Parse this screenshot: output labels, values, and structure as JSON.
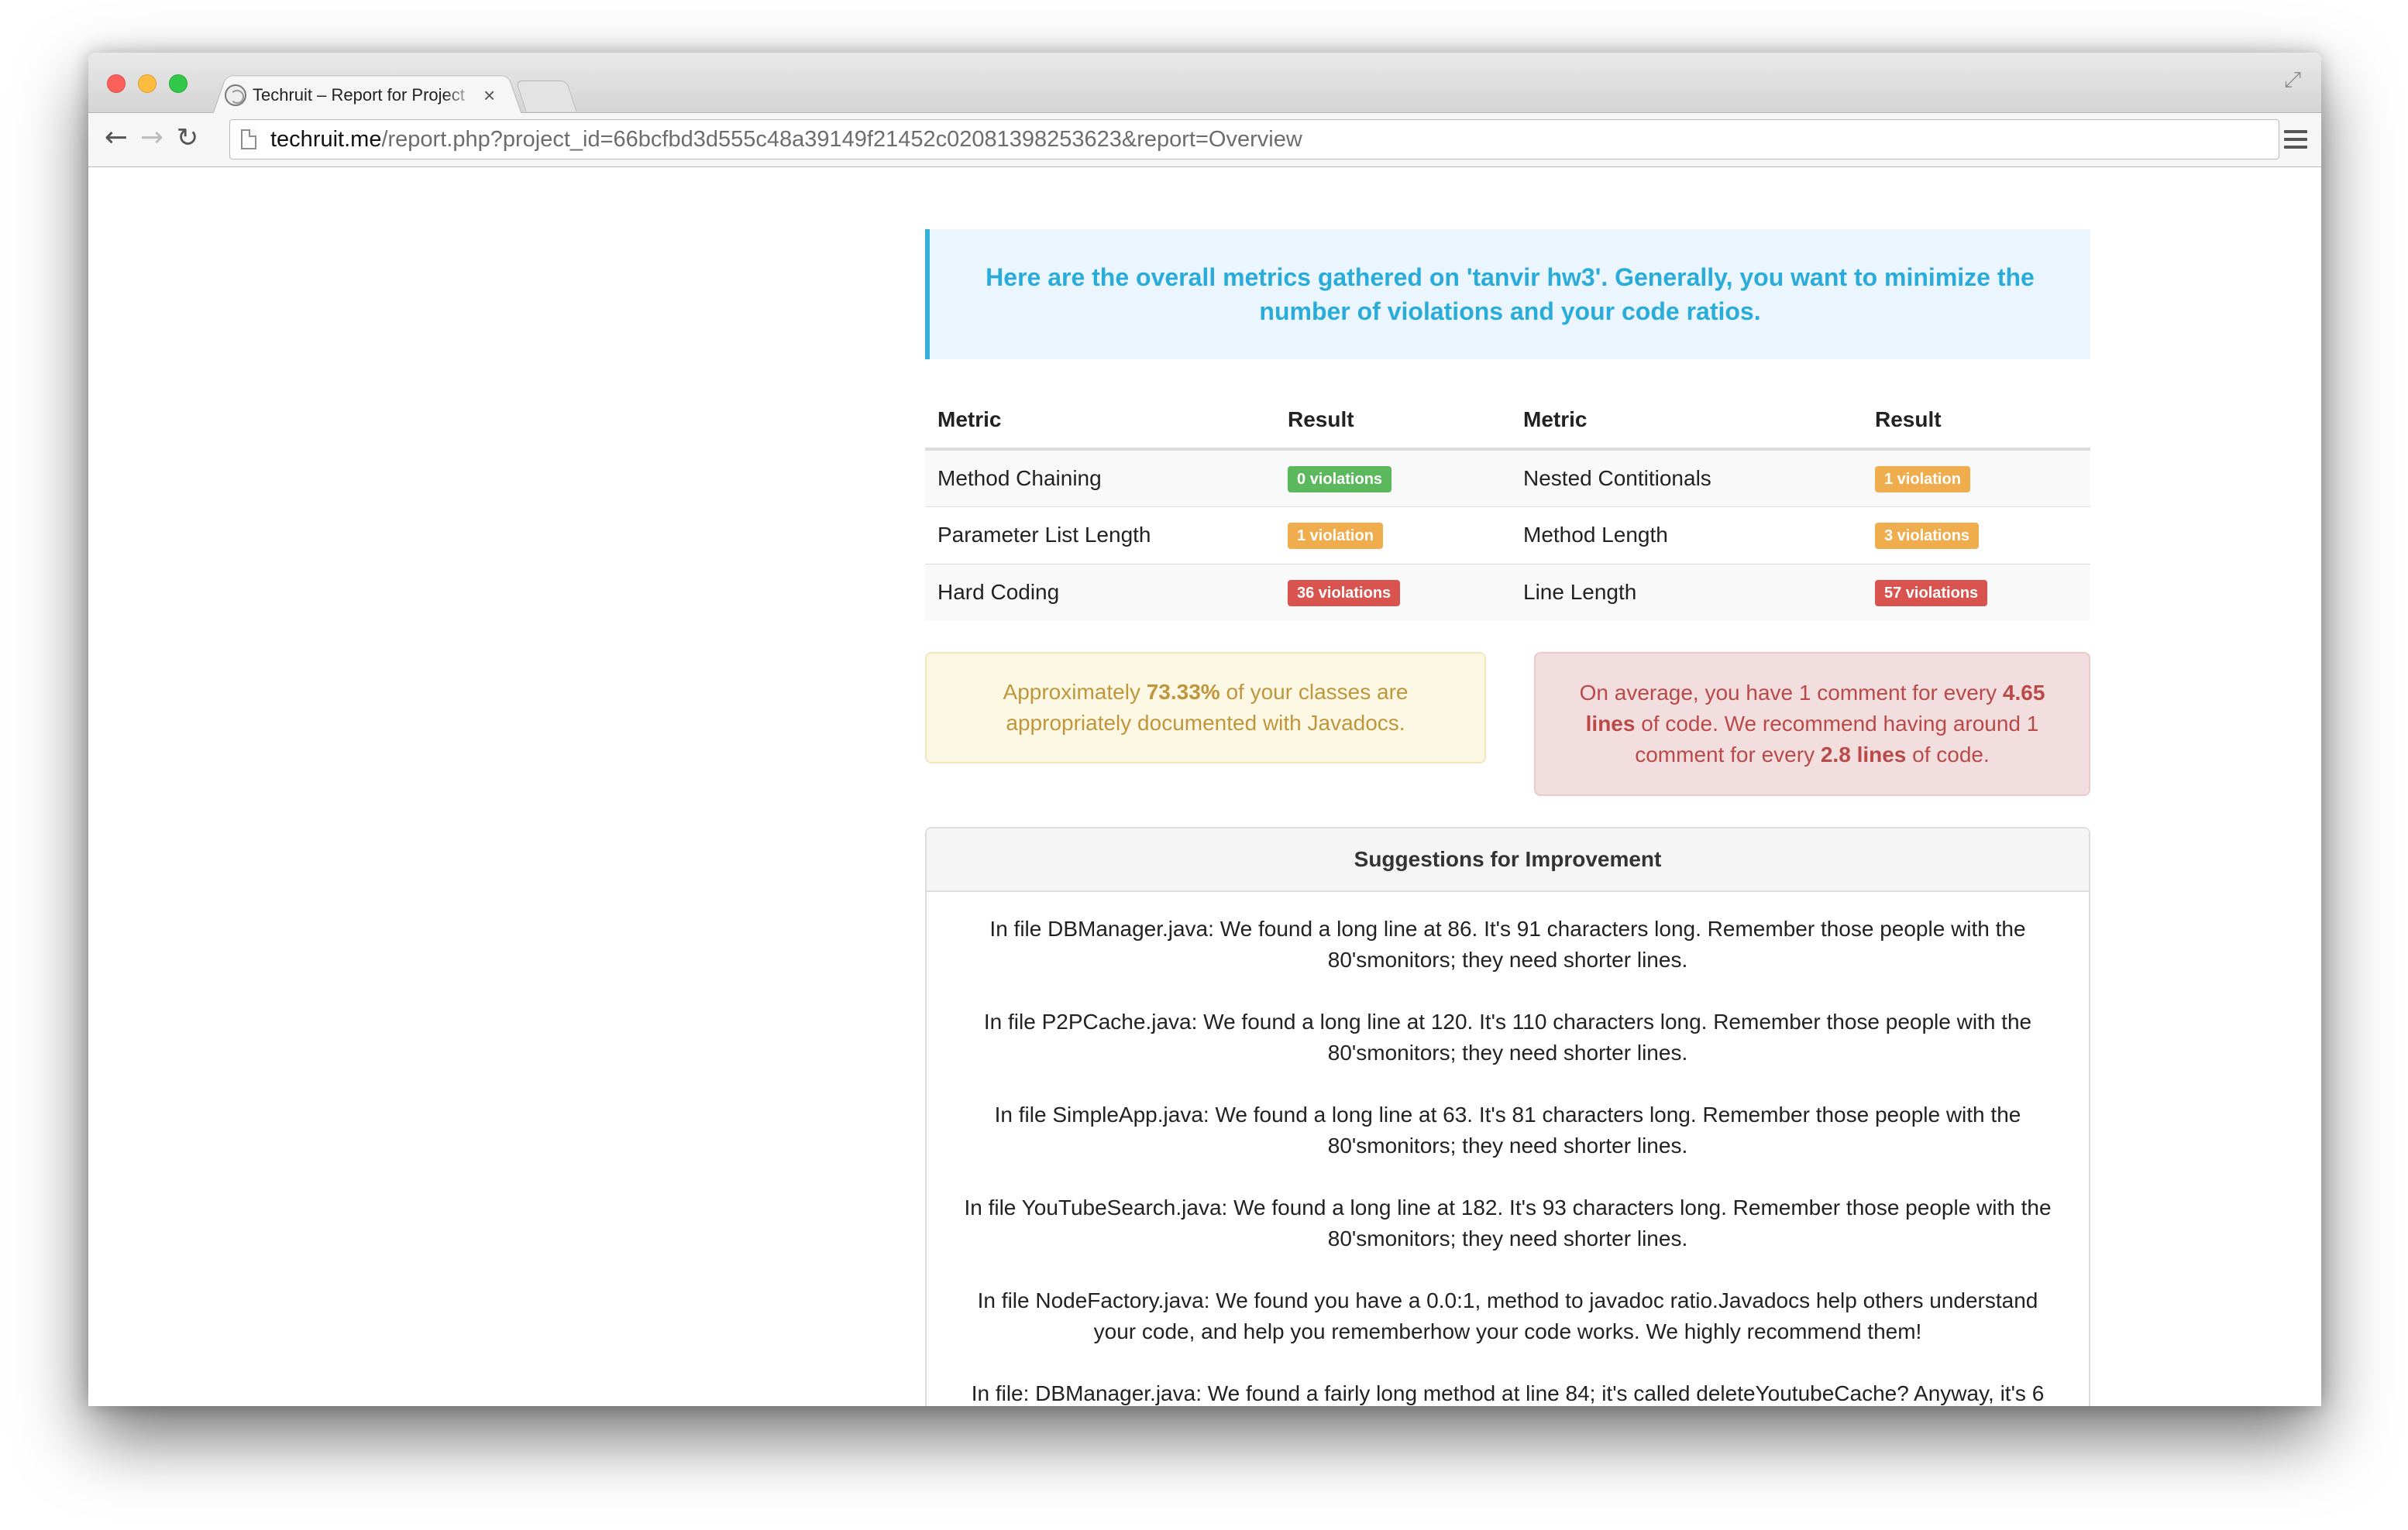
{
  "browser": {
    "tab_title": "Techruit – Report for Project",
    "tab_close": "×",
    "url_host": "techruit.me",
    "url_path": "/report.php?project_id=66bcfbd3d555c48a39149f21452c02081398253623&report=Overview",
    "icons": {
      "back": "arrow-left",
      "forward": "arrow-right",
      "reload": "reload",
      "menu": "hamburger",
      "fullscreen": "expand-arrows"
    }
  },
  "intro": {
    "text": "Here are the overall metrics gathered on 'tanvir hw3'. Generally, you want to minimize the number of violations and your code ratios."
  },
  "metrics_table": {
    "headers": [
      "Metric",
      "Result",
      "Metric",
      "Result"
    ],
    "rows": [
      {
        "metric1": "Method Chaining",
        "result1": "0 violations",
        "result1_color": "green",
        "metric2": "Nested Contitionals",
        "result2": "1 violation",
        "result2_color": "orange"
      },
      {
        "metric1": "Parameter List Length",
        "result1": "1 violation",
        "result1_color": "orange",
        "metric2": "Method Length",
        "result2": "3 violations",
        "result2_color": "orange"
      },
      {
        "metric1": "Hard Coding",
        "result1": "36 violations",
        "result1_color": "red",
        "metric2": "Line Length",
        "result2": "57 violations",
        "result2_color": "red"
      }
    ]
  },
  "javadoc_alert": {
    "prefix": "Approximately ",
    "percent": "73.33%",
    "suffix": " of your classes are appropriately documented with Javadocs."
  },
  "comment_alert": {
    "part1": "On average, you have 1 comment for every ",
    "value1": "4.65 lines",
    "part2": " of code. We recommend having around 1 comment for every ",
    "value2": "2.8 lines",
    "part3": " of code."
  },
  "suggestions": {
    "heading": "Suggestions for Improvement",
    "items": [
      "In file DBManager.java: We found a long line at 86. It's 91 characters long. Remember those people with the 80'smonitors; they need shorter lines.",
      "In file P2PCache.java: We found a long line at 120. It's 110 characters long. Remember those people with the 80'smonitors; they need shorter lines.",
      "In file SimpleApp.java: We found a long line at 63. It's 81 characters long. Remember those people with the 80'smonitors; they need shorter lines.",
      "In file YouTubeSearch.java: We found a long line at 182. It's 93 characters long. Remember those people with the 80'smonitors; they need shorter lines.",
      "In file NodeFactory.java: We found you have a 0.0:1, method to javadoc ratio.Javadocs help others understand your code, and help you rememberhow your code works. We highly recommend them!",
      "In file: DBManager.java: We found a fairly long method at line 84; it's called deleteYoutubeCache? Anyway, it's 6"
    ]
  },
  "colors": {
    "callout_text": "#29acd9",
    "callout_bg": "#ebf5fd",
    "badge_green": "#5cb85c",
    "badge_orange": "#f0ad4e",
    "badge_red": "#d9534f",
    "warn_text": "#c0963d",
    "danger_text": "#b94a48"
  }
}
